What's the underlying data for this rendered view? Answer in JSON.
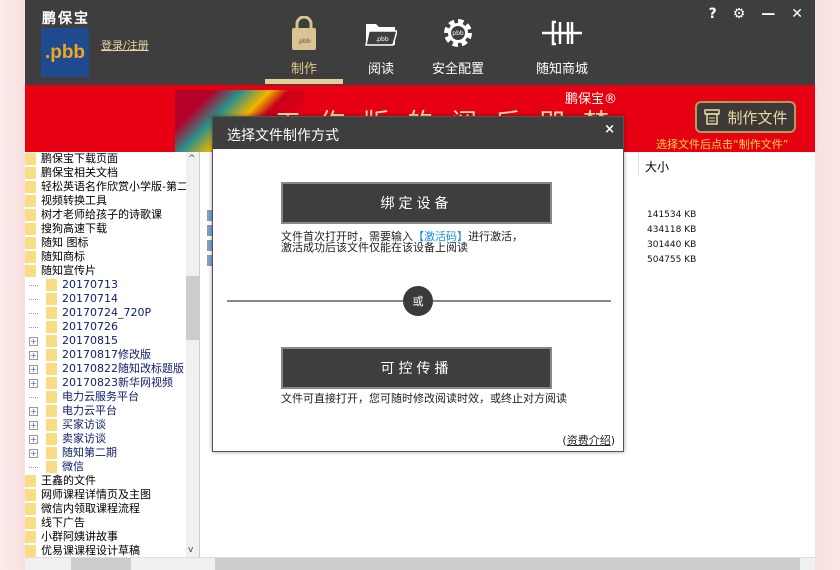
{
  "header": {
    "brand": "鹏保宝",
    "logo_text": ".pbb",
    "login": "登录/注册",
    "nav": [
      {
        "label": "制作",
        "icon": "lock-pbb-icon"
      },
      {
        "label": "阅读",
        "icon": "folder-pbb-icon"
      },
      {
        "label": "安全配置",
        "icon": "gear-pbb-icon"
      },
      {
        "label": "随知商城",
        "icon": "shop-logo-icon"
      }
    ],
    "controls": {
      "help": "?",
      "settings": "⚙",
      "minimize": "—",
      "close": "✕"
    }
  },
  "banner": {
    "text": "工作版的阅后即焚",
    "logo": "鹏保宝®",
    "make_button": "制作文件",
    "hint": "选择文件后点击“制作文件”"
  },
  "tree": {
    "items": [
      {
        "label": "鹏保宝下载页面",
        "level": 0
      },
      {
        "label": "鹏保宝相关文档",
        "level": 0
      },
      {
        "label": "轻松英语名作欣赏小学版-第二",
        "level": 0
      },
      {
        "label": "视频转换工具",
        "level": 0
      },
      {
        "label": "树才老师给孩子的诗歌课",
        "level": 0
      },
      {
        "label": "搜狗高速下载",
        "level": 0
      },
      {
        "label": "随知 图标",
        "level": 0
      },
      {
        "label": "随知商标",
        "level": 0
      },
      {
        "label": "随知宣传片",
        "level": 0
      },
      {
        "label": "20170713",
        "level": 1,
        "expand": false
      },
      {
        "label": "20170714",
        "level": 1,
        "expand": false
      },
      {
        "label": "20170724_720P",
        "level": 1,
        "expand": false
      },
      {
        "label": "20170726",
        "level": 1,
        "expand": false
      },
      {
        "label": "20170815",
        "level": 1,
        "expand": true
      },
      {
        "label": "20170817修改版",
        "level": 1,
        "expand": true
      },
      {
        "label": "20170822随知改标题版",
        "level": 1,
        "expand": true
      },
      {
        "label": "20170823新华网视频",
        "level": 1,
        "expand": true
      },
      {
        "label": "电力云服务平台",
        "level": 1,
        "expand": false
      },
      {
        "label": "电力云平台",
        "level": 1,
        "expand": true
      },
      {
        "label": "买家访谈",
        "level": 1,
        "expand": true
      },
      {
        "label": "卖家访谈",
        "level": 1,
        "expand": true
      },
      {
        "label": "随知第二期",
        "level": 1,
        "expand": true
      },
      {
        "label": "微信",
        "level": 1,
        "expand": false
      },
      {
        "label": "王鑫的文件",
        "level": 0
      },
      {
        "label": "网师课程详情页及主图",
        "level": 0
      },
      {
        "label": "微信内领取课程流程",
        "level": 0
      },
      {
        "label": "线下广告",
        "level": 0
      },
      {
        "label": "小群阿姨讲故事",
        "level": 0
      },
      {
        "label": "优易课课程设计草稿",
        "level": 0
      }
    ]
  },
  "files": {
    "column_size": "大小",
    "sizes": [
      "141534 KB",
      "434118 KB",
      "301440 KB",
      "504755 KB"
    ]
  },
  "dialog": {
    "title": "选择文件制作方式",
    "close": "×",
    "bind_button": "绑定设备",
    "bind_desc_1": "文件首次打开时，需要输入",
    "bind_desc_code": "【激活码】",
    "bind_desc_2": "进行激活，",
    "bind_desc_3": "激活成功后该文件仅能在该设备上阅读",
    "or": "或",
    "control_button": "可控传播",
    "control_desc": "文件可直接打开，您可随时修改阅读时效，或终止对方阅读",
    "fee_open": "(",
    "fee_link": "资费介绍",
    "fee_close": ")"
  }
}
